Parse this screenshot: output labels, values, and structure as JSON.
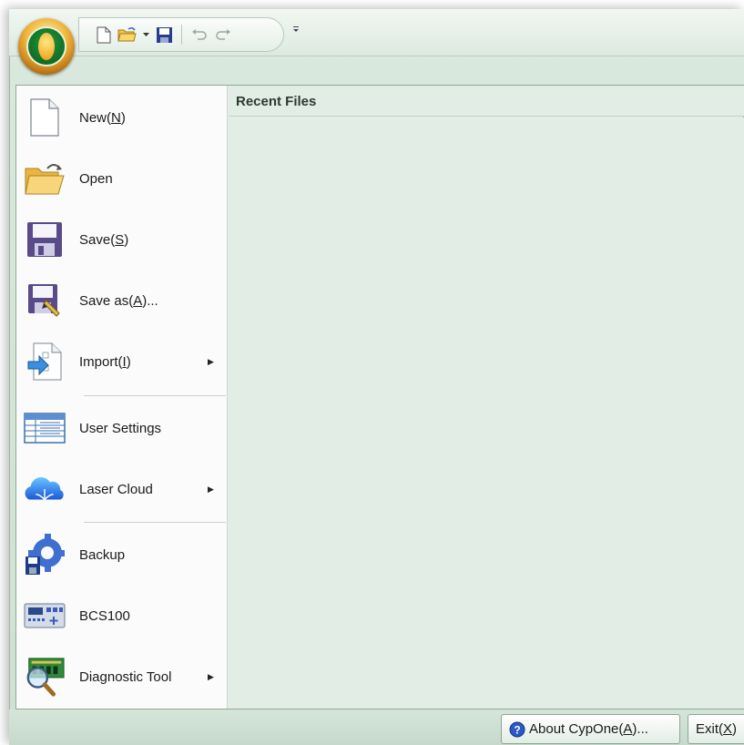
{
  "colors": {
    "accent": "#2e7d40",
    "panel": "#e2ede5",
    "menu_bg": "#fafbfa"
  },
  "app_menu": {
    "items": [
      {
        "label_pre": "New(",
        "hotkey": "N",
        "label_post": ")",
        "icon": "new-file-icon",
        "submenu": false
      },
      {
        "label_pre": "Open",
        "hotkey": "",
        "label_post": "",
        "icon": "open-folder-icon",
        "submenu": false
      },
      {
        "label_pre": "Save(",
        "hotkey": "S",
        "label_post": ")",
        "icon": "save-icon",
        "submenu": false
      },
      {
        "label_pre": "Save as(",
        "hotkey": "A",
        "label_post": ")...",
        "icon": "save-as-icon",
        "submenu": false
      },
      {
        "label_pre": "Import(",
        "hotkey": "I",
        "label_post": ")",
        "icon": "import-icon",
        "submenu": true
      },
      {
        "label_pre": "User Settings",
        "hotkey": "",
        "label_post": "",
        "icon": "user-settings-icon",
        "submenu": false
      },
      {
        "label_pre": "Laser Cloud",
        "hotkey": "",
        "label_post": "",
        "icon": "cloud-icon",
        "submenu": true
      },
      {
        "label_pre": "Backup",
        "hotkey": "",
        "label_post": "",
        "icon": "backup-icon",
        "submenu": false
      },
      {
        "label_pre": "BCS100",
        "hotkey": "",
        "label_post": "",
        "icon": "controller-icon",
        "submenu": false
      },
      {
        "label_pre": "Diagnostic Tool",
        "hotkey": "",
        "label_post": "",
        "icon": "diagnostic-icon",
        "submenu": true
      }
    ]
  },
  "recent_files": {
    "title": "Recent Files",
    "items": []
  },
  "footer": {
    "about": {
      "label_pre": "About CypOne(",
      "hotkey": "A",
      "label_post": ")..."
    },
    "exit": {
      "label_pre": "Exit(",
      "hotkey": "X",
      "label_post": ")"
    }
  }
}
